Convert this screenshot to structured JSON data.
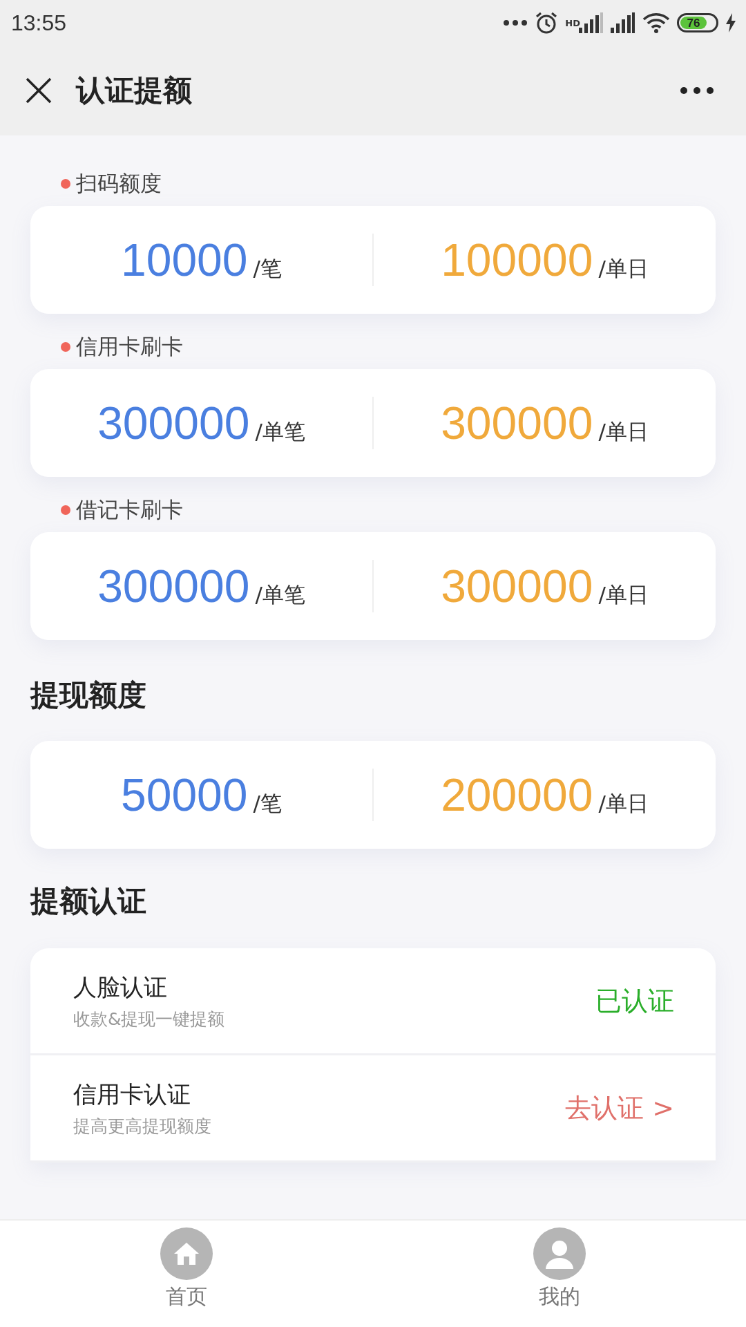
{
  "status_bar": {
    "time": "13:55",
    "network_label": "HD",
    "battery": "76"
  },
  "header": {
    "title": "认证提额"
  },
  "payment_limits": [
    {
      "label": "扫码额度",
      "single": {
        "value": "10000",
        "unit": "/笔"
      },
      "daily": {
        "value": "100000",
        "unit": "/单日"
      }
    },
    {
      "label": "信用卡刷卡",
      "single": {
        "value": "300000",
        "unit": "/单笔"
      },
      "daily": {
        "value": "300000",
        "unit": "/单日"
      }
    },
    {
      "label": "借记卡刷卡",
      "single": {
        "value": "300000",
        "unit": "/单笔"
      },
      "daily": {
        "value": "300000",
        "unit": "/单日"
      }
    }
  ],
  "withdraw": {
    "heading": "提现额度",
    "single": {
      "value": "50000",
      "unit": "/笔"
    },
    "daily": {
      "value": "200000",
      "unit": "/单日"
    }
  },
  "verification": {
    "heading": "提额认证",
    "items": [
      {
        "title": "人脸认证",
        "subtitle": "收款&提现一键提额",
        "status": "已认证",
        "kind": "done"
      },
      {
        "title": "信用卡认证",
        "subtitle": "提高更高提现额度",
        "status": "去认证 >",
        "kind": "todo"
      }
    ]
  },
  "tab_bar": [
    {
      "label": "首页",
      "kind": "home"
    },
    {
      "label": "我的",
      "kind": "profile"
    }
  ]
}
